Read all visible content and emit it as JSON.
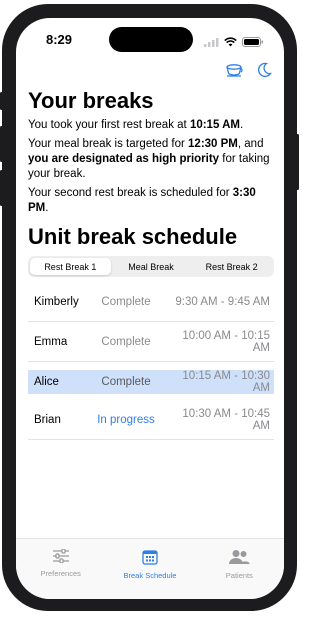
{
  "status_bar": {
    "time": "8:29"
  },
  "header_icons": [
    {
      "icon": "coffee-cup-icon"
    },
    {
      "icon": "moon-icon"
    }
  ],
  "your_breaks": {
    "title": "Your breaks",
    "para1_pre": "You took your first rest break at ",
    "para1_time": "10:15 AM",
    "para1_post": ".",
    "para2_pre": "Your meal break is targeted for ",
    "para2_time": "12:30 PM",
    "para2_mid": ", and ",
    "para2_bold": "you are designated as high priority",
    "para2_post": " for taking your break.",
    "para3_pre": "Your second rest break is scheduled for ",
    "para3_time": "3:30 PM",
    "para3_post": "."
  },
  "unit_schedule": {
    "title": "Unit break schedule",
    "segments": [
      "Rest Break 1",
      "Meal Break",
      "Rest Break 2"
    ],
    "selected_segment": "Rest Break 1",
    "rows": [
      {
        "name": "Kimberly",
        "status": "Complete",
        "time": "9:30 AM - 9:45 AM"
      },
      {
        "name": "Emma",
        "status": "Complete",
        "time": "10:00 AM - 10:15 AM"
      },
      {
        "name": "Alice",
        "status": "Complete",
        "time": "10:15 AM - 10:30 AM"
      },
      {
        "name": "Brian",
        "status": "In progress",
        "time": "10:30 AM - 10:45 AM"
      }
    ]
  },
  "tab_bar": {
    "tabs": [
      {
        "label": "Preferences",
        "icon": "sliders-icon"
      },
      {
        "label": "Break Schedule",
        "icon": "calendar-icon"
      },
      {
        "label": "Patients",
        "icon": "people-icon"
      }
    ],
    "active": "Break Schedule"
  },
  "colors": {
    "accent": "#2f7fe6",
    "highlight_row": "#cfe0fb",
    "secondary_text": "#8a8a8e"
  }
}
